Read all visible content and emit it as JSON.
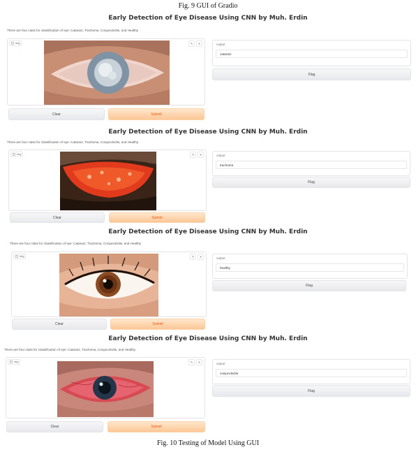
{
  "captions": {
    "top": "Fig. 9 GUI of Gradio",
    "bottom": "Fig. 10 Testing of Model Using GUI"
  },
  "panels": [
    {
      "title": "Early Detection of Eye Disease Using CNN by Muh. Erdin",
      "description": "There are four class for classification of eye: Cataract, Trachoma, Conjunctivitis, and Healthy",
      "input_label": "img",
      "output_label": "output",
      "output_value": "cataract",
      "clear_label": "Clear",
      "submit_label": "Submit",
      "flag_label": "Flag",
      "image": "cataract-eye-photo"
    },
    {
      "title": "Early Detection of Eye Disease Using CNN by Muh. Erdin",
      "description": "There are four class for classification of eye: Cataract, Trachoma, Conjunctivitis, and Healthy",
      "input_label": "img",
      "output_label": "output",
      "output_value": "trachoma",
      "clear_label": "Clear",
      "submit_label": "Submit",
      "flag_label": "Flag",
      "image": "trachoma-eyelid-photo"
    },
    {
      "title": "Early Detection of Eye Disease Using CNN by Muh. Erdin",
      "description": "There are four class for classification of eye: Cataract, Trachoma, Conjunctivitis, and Healthy",
      "input_label": "img",
      "output_label": "output",
      "output_value": "healthy",
      "clear_label": "Clear",
      "submit_label": "Submit",
      "flag_label": "Flag",
      "image": "healthy-eye-photo"
    },
    {
      "title": "Early Detection of Eye Disease Using CNN by Muh. Erdin",
      "description": "There are four class for classification of eye: Cataract, Trachoma, Conjunctivitis, and Healthy",
      "input_label": "img",
      "output_label": "output",
      "output_value": "conjunctivitis",
      "clear_label": "Clear",
      "submit_label": "Submit",
      "flag_label": "Flag",
      "image": "conjunctivitis-eye-photo"
    }
  ],
  "colors": {
    "submit_bg": "#fcc796",
    "submit_text": "#ea580c",
    "secondary_bg": "#e8e9ec"
  }
}
